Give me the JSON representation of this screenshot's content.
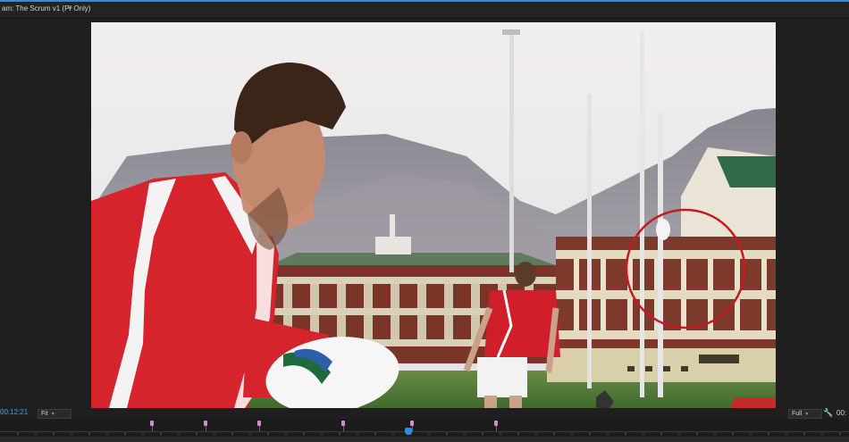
{
  "panel": {
    "tab_title": "am: The Scrum v1 (Pr Only)",
    "menu_icon": "panel-menu-icon"
  },
  "viewer": {
    "highlight_color": "#c61a1f",
    "accent_color": "#2d8ceb"
  },
  "controls": {
    "playhead_timecode": "00:12:21",
    "zoom_level": "Fit",
    "resolution": "Full",
    "settings_icon": "wrench-icon",
    "duration_timecode": "00:"
  },
  "timeline": {
    "marker_color": "#d58ad8",
    "marker_count": 6
  }
}
